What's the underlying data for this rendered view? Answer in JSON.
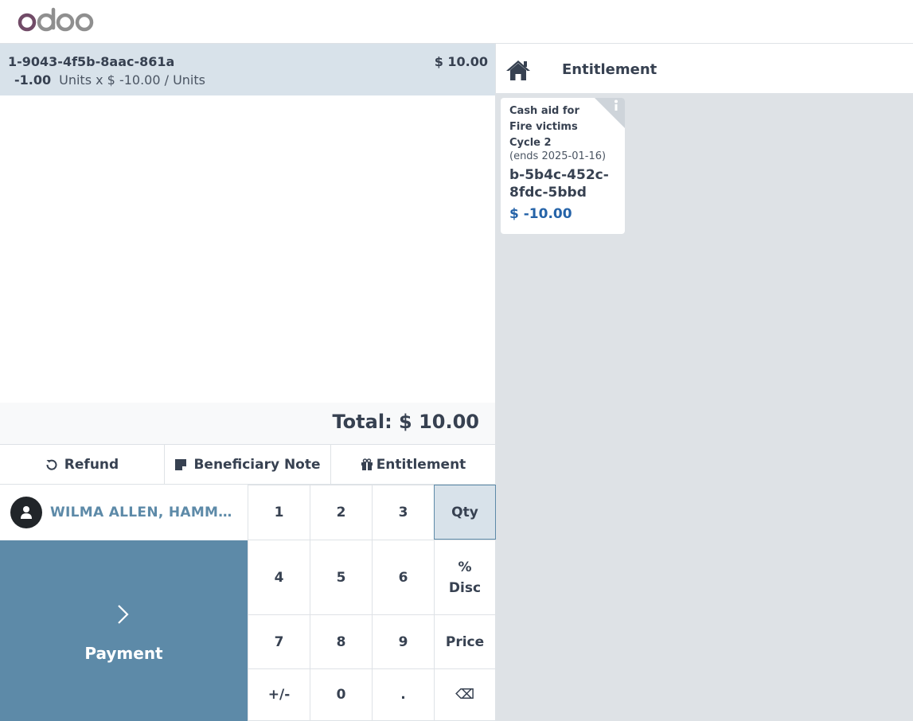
{
  "header": {
    "logo_text": "odoo"
  },
  "orderline": {
    "product": "1-9043-4f5b-8aac-861a",
    "price": "$ 10.00",
    "qty": "-1.00",
    "unit_info": "Units x $ -10.00 / Units"
  },
  "summary": {
    "total": "Total: $ 10.00"
  },
  "controls": {
    "refund": "Refund",
    "note": "Beneficiary Note",
    "entitlement": "Entitlement"
  },
  "customer": {
    "name": "WILMA ALLEN, HAMMERSMITH"
  },
  "payment": {
    "label": "Payment"
  },
  "numpad": {
    "k1": "1",
    "k2": "2",
    "k3": "3",
    "qty": "Qty",
    "k4": "4",
    "k5": "5",
    "k6": "6",
    "disc_a": "%",
    "disc_b": "Disc",
    "k7": "7",
    "k8": "8",
    "k9": "9",
    "price": "Price",
    "sign": "+/-",
    "k0": "0",
    "dot": ".",
    "backspace": "⌫"
  },
  "category": {
    "label": "Entitlement"
  },
  "product_card": {
    "title": "Cash aid for Fire victims",
    "cycle": "Cycle 2",
    "ends": "(ends 2025-01-16)",
    "code": "b-5b4c-452c-8fdc-5bbd",
    "price": "$ -10.00"
  },
  "colors": {
    "accent": "#5d8aa8",
    "selected": "#d8e2ea",
    "price_blue": "#2563a8",
    "brand": "#714b67"
  }
}
